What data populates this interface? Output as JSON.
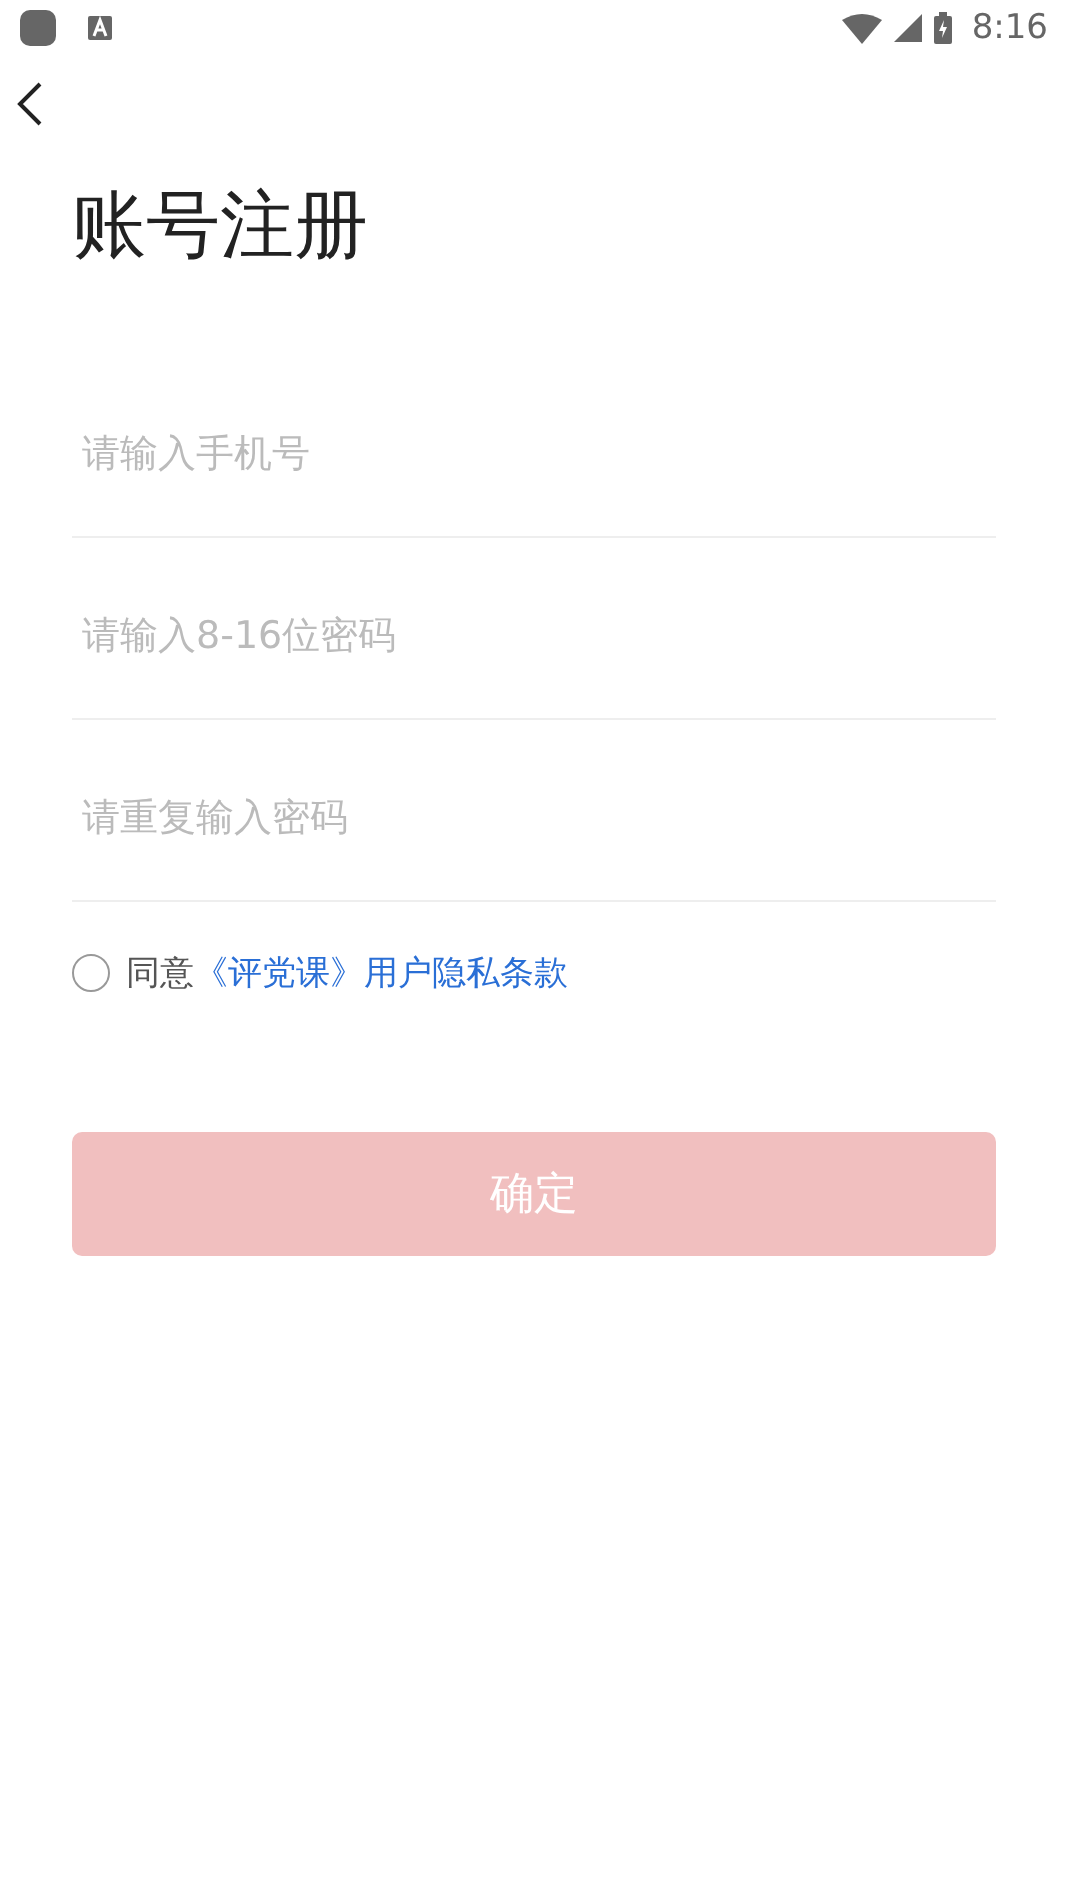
{
  "status_bar": {
    "time": "8:16"
  },
  "title": "账号注册",
  "fields": [
    {
      "placeholder": "请输入手机号"
    },
    {
      "placeholder": "请输入8-16位密码"
    },
    {
      "placeholder": "请重复输入密码"
    }
  ],
  "agreement": {
    "checked": false,
    "text": "同意",
    "link": "《评党课》用户隐私条款"
  },
  "submit": {
    "label": "确定",
    "disabled": true
  }
}
